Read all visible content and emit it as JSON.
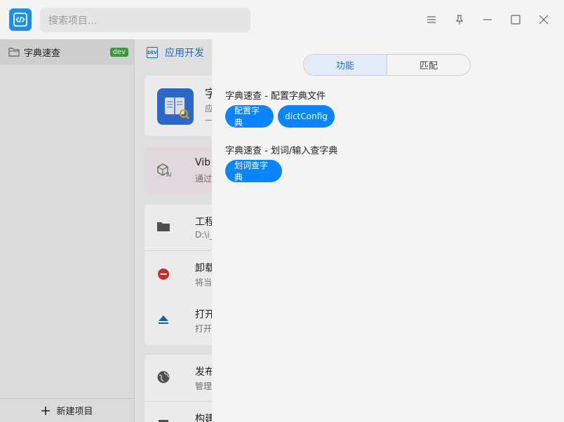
{
  "search": {
    "placeholder": "搜索项目..."
  },
  "window_controls": [
    "menu-icon",
    "pin-icon",
    "minimize-icon",
    "maximize-icon",
    "close-icon"
  ],
  "sidebar": {
    "project": {
      "name": "字典速查",
      "badge": "dev"
    },
    "new_project_label": "新建项目"
  },
  "mid": {
    "header": "应用开发",
    "card_title": "字",
    "card_lines": [
      "应",
      "—"
    ],
    "vibe": {
      "title": "Vib",
      "sub": "通过"
    },
    "rows": [
      {
        "title": "工程",
        "sub": "D:\\i_"
      },
      {
        "title": "卸载",
        "sub": "将当"
      },
      {
        "title": "打开",
        "sub": "打开"
      },
      {
        "title": "发布",
        "sub": "管理"
      },
      {
        "title": "构建",
        "sub": ""
      }
    ]
  },
  "drawer": {
    "tabs": {
      "active": "功能",
      "inactive": "匹配"
    },
    "sections": [
      {
        "title": "字典速查 - 配置字典文件",
        "buttons": [
          "配置字典",
          "dictConfig"
        ]
      },
      {
        "title": "字典速查 - 划词/输入查字典",
        "buttons": [
          "划词查字典"
        ]
      }
    ]
  },
  "colors": {
    "accent": "#0a84ff",
    "logo": "#1b8ef0",
    "badge": "#43a047"
  }
}
